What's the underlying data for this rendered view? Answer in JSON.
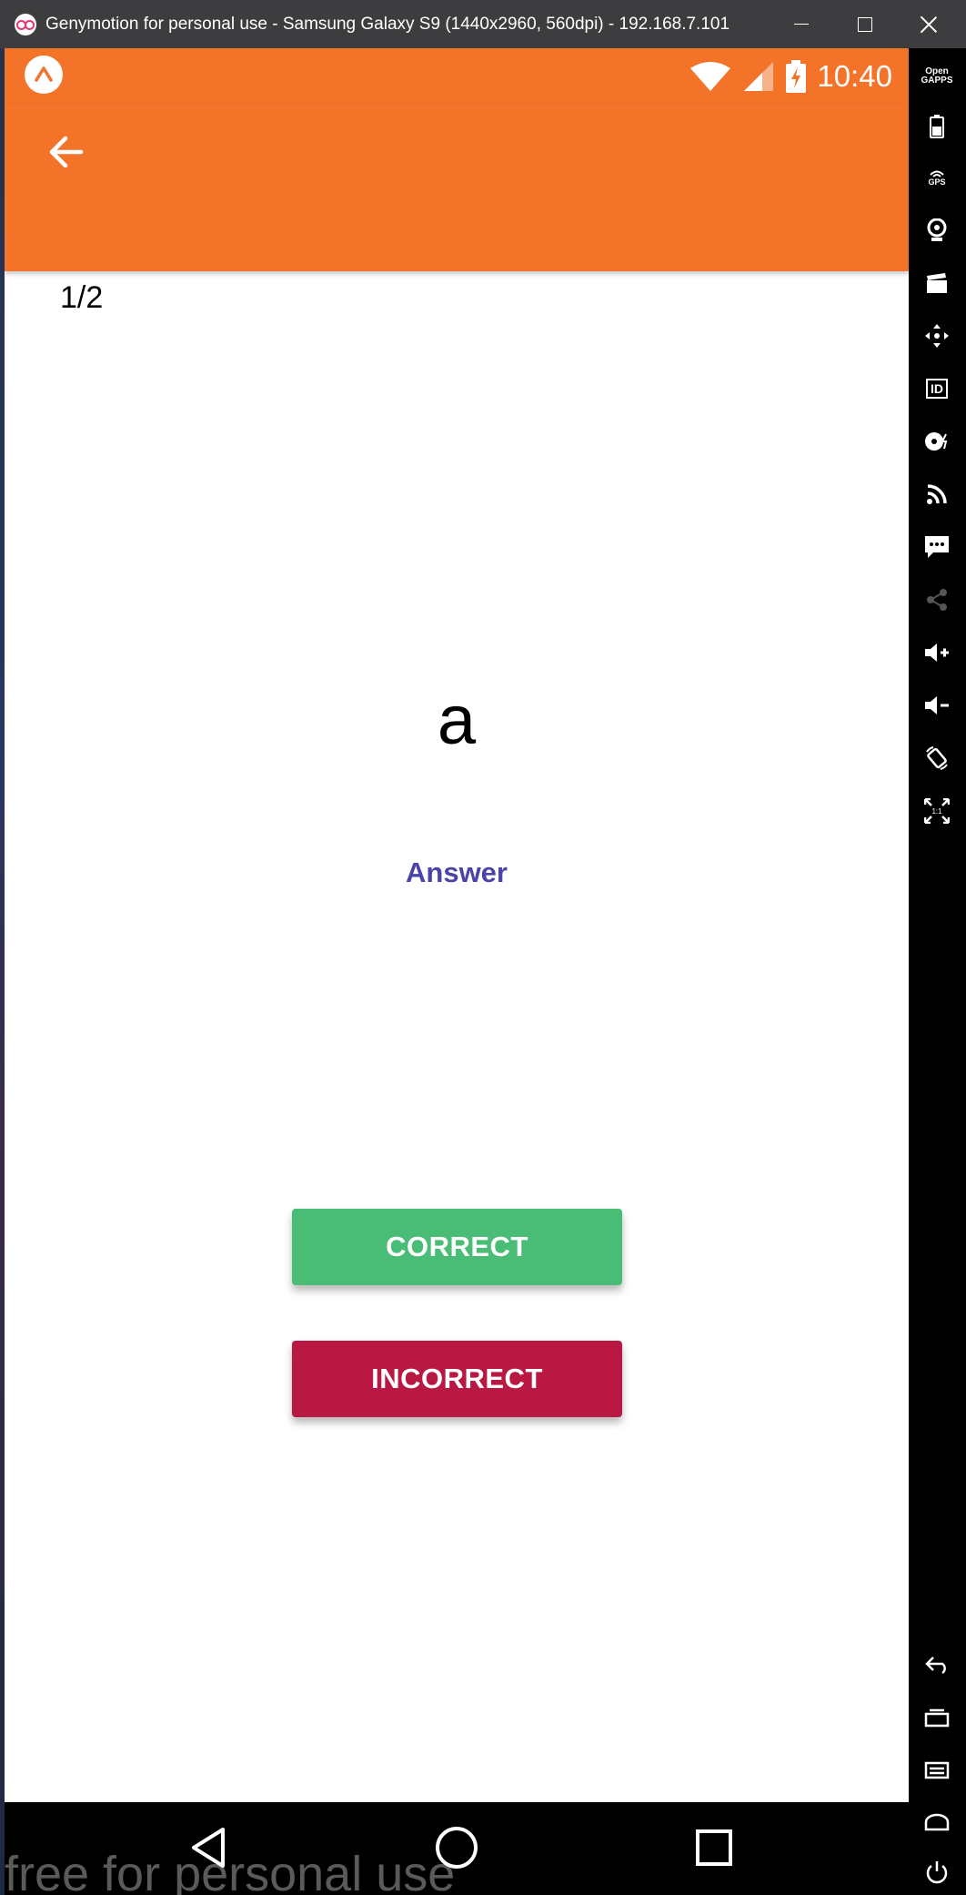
{
  "window": {
    "title": "Genymotion for personal use - Samsung Galaxy S9 (1440x2960, 560dpi) - 192.168.7.101"
  },
  "status_bar": {
    "time": "10:40",
    "color": "#f37329"
  },
  "screen": {
    "counter": "1/2",
    "question": "a",
    "answer_link": "Answer",
    "correct_label": "CORRECT",
    "incorrect_label": "INCORRECT",
    "colors": {
      "correct": "#49bd76",
      "incorrect": "#b91843",
      "answer_link": "#4a44a8"
    }
  },
  "toolbar": {
    "gapps_label": "Open\nGAPPS",
    "gps_label": "GPS",
    "id_label": "ID",
    "pixel_label": "1:1"
  },
  "watermark": "free for personal use"
}
